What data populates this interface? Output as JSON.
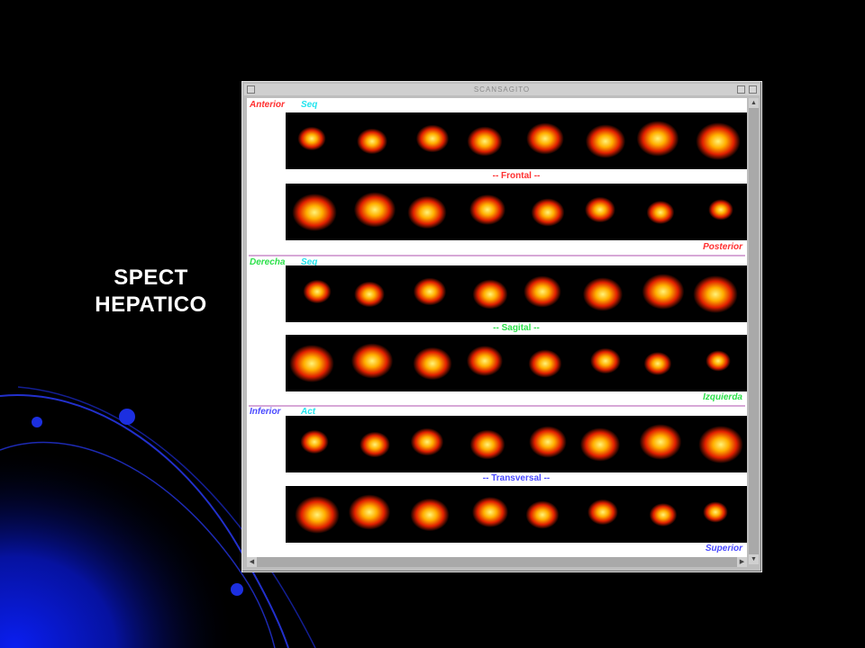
{
  "slide": {
    "title_line1": "SPECT",
    "title_line2": "HEPATICO"
  },
  "window": {
    "title": "SCANSAGITO"
  },
  "sections": [
    {
      "top_left_label": "Anterior",
      "top_left_label2": "Seq",
      "center_label": "-- Frontal --",
      "bottom_right_label": "Posterior",
      "colors": {
        "main": "#ff3030"
      }
    },
    {
      "top_left_label": "Derecha",
      "top_left_label2": "Seq",
      "center_label": "-- Sagital --",
      "bottom_right_label": "Izquierda",
      "colors": {
        "main": "#2ce04a"
      }
    },
    {
      "top_left_label": "Inferior",
      "top_left_label2": "Act",
      "center_label": "-- Transversal --",
      "bottom_right_label": "Superior",
      "colors": {
        "main": "#4a4aff"
      }
    }
  ]
}
